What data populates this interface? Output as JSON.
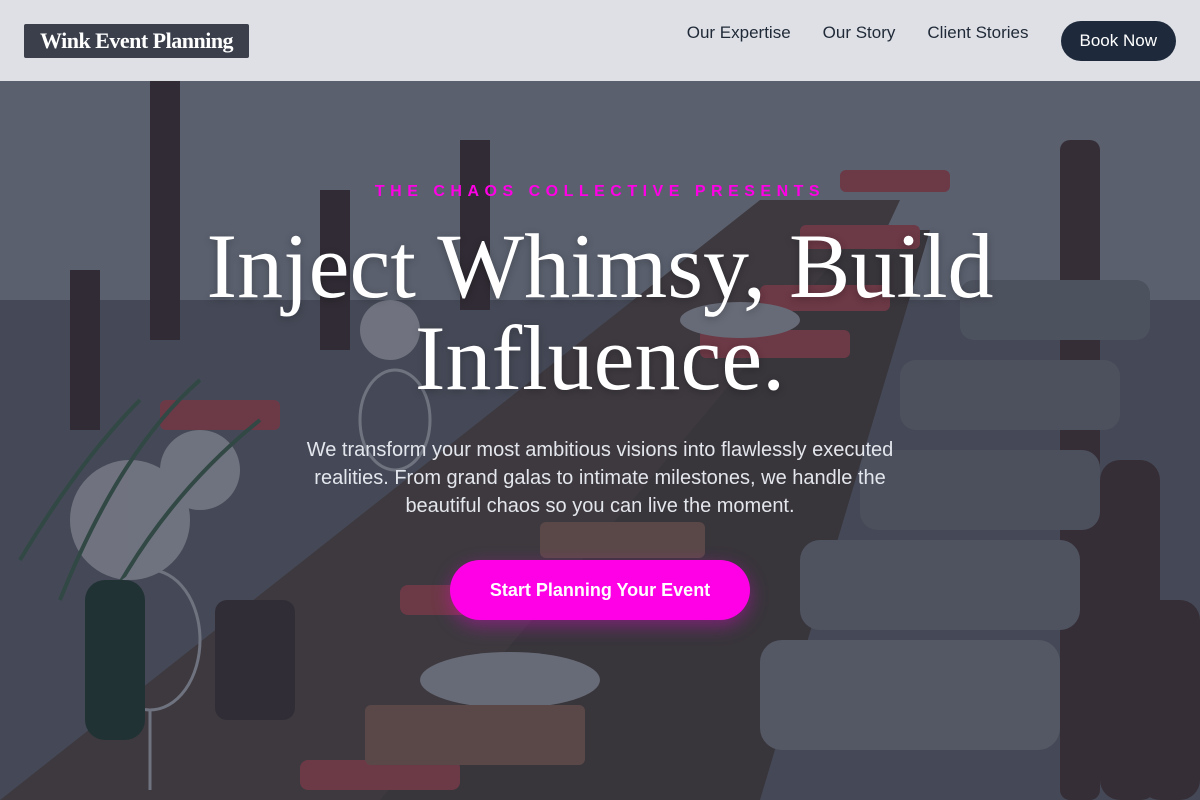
{
  "brand": {
    "name": "Wink Event Planning"
  },
  "nav": {
    "items": [
      {
        "label": "Our Expertise"
      },
      {
        "label": "Our Story"
      },
      {
        "label": "Client Stories"
      }
    ],
    "cta_label": "Book Now"
  },
  "hero": {
    "eyebrow": "THE CHAOS COLLECTIVE PRESENTS",
    "headline": "Inject Whimsy, Build Influence.",
    "subtext": "We transform your most ambitious visions into flawlessly executed realities. From grand galas to intimate milestones, we handle the beautiful chaos so you can live the moment.",
    "cta_label": "Start Planning Your Event",
    "background_image": "banquet-table-photo"
  },
  "colors": {
    "accent": "#ff00e6",
    "header_bg": "#e8eaee",
    "brand_bg": "#3a3f4b",
    "book_button_bg": "#1e2a3c",
    "overlay": "#262c3c"
  }
}
